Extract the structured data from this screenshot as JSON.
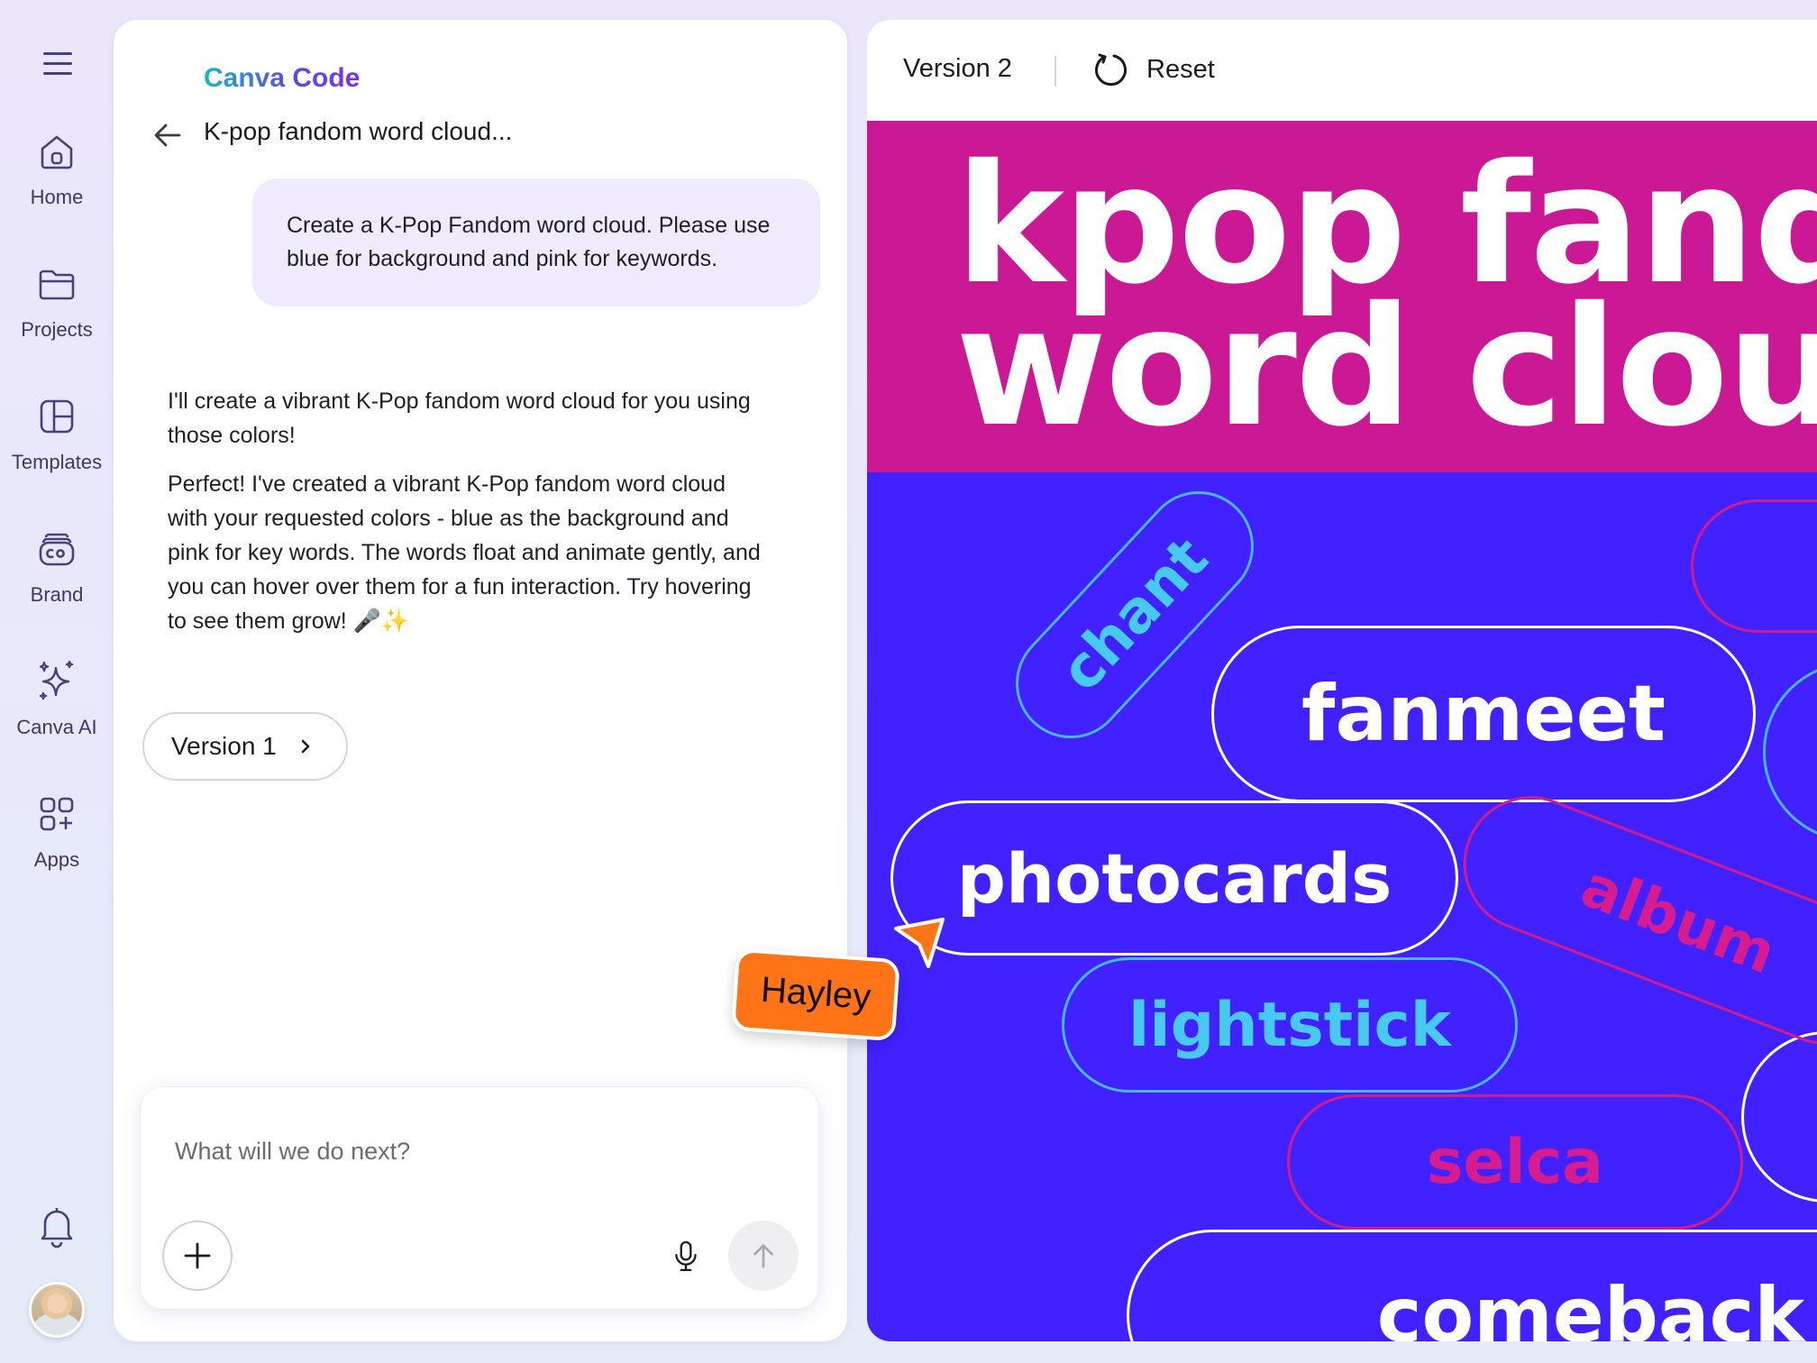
{
  "rail": {
    "items": [
      {
        "label": "Home",
        "icon": "home-icon"
      },
      {
        "label": "Projects",
        "icon": "folder-icon"
      },
      {
        "label": "Templates",
        "icon": "templates-icon"
      },
      {
        "label": "Brand",
        "icon": "brand-icon"
      },
      {
        "label": "Canva AI",
        "icon": "sparkles-icon"
      },
      {
        "label": "Apps",
        "icon": "apps-icon"
      }
    ]
  },
  "chat": {
    "brand": "Canva Code",
    "title": "K-pop fandom word cloud...",
    "user_message": "Create a K-Pop Fandom word cloud. Please use blue for background and pink for keywords.",
    "reply_1": "I'll create a vibrant K-Pop fandom word cloud for you using those colors!",
    "reply_2": "Perfect! I've created a vibrant K-Pop fandom word cloud with your requested colors -  blue as the background and pink for key words. The words float and animate gently, and you can hover over them for a fun interaction. Try hovering to see them grow! 🎤✨",
    "version_chip": "Version 1",
    "composer_placeholder": "What will we do next?"
  },
  "cursor": {
    "name": "Hayley",
    "color": "#ff7417"
  },
  "preview": {
    "version": "Version 2",
    "reset": "Reset",
    "title_line_1": "kpop fandom",
    "title_line_2": "word cloud",
    "colors": {
      "background": "#4121ff",
      "banner": "#cb1894",
      "pink": "#d61c8e",
      "cyan": "#48c9f0",
      "white": "#ffffff"
    },
    "words": [
      {
        "text": "chant",
        "style": "cyan"
      },
      {
        "text": "fanmeet",
        "style": "white"
      },
      {
        "text": "photocards",
        "style": "white"
      },
      {
        "text": "album",
        "style": "pink"
      },
      {
        "text": "lightstick",
        "style": "cyan"
      },
      {
        "text": "selca",
        "style": "pink"
      },
      {
        "text": "comeback",
        "style": "white"
      }
    ]
  }
}
